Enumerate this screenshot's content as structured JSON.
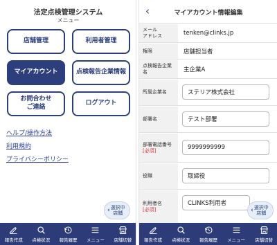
{
  "left": {
    "title": "法定点検管理システム",
    "subtitle": "メニュー",
    "buttons": [
      "店舗管理",
      "利用者管理",
      "マイアカウント",
      "点検報告企業情報",
      "お問合わせ\nご連絡",
      "ログアウト"
    ],
    "links": [
      "ヘルプ/操作方法",
      "利用規約",
      "プライバシーポリシー"
    ],
    "store_float": {
      "line1": "選択中",
      "line2": "店舗"
    }
  },
  "right": {
    "title": "マイアカウント情報編集",
    "fields": [
      {
        "label": "メール\nアドレス",
        "value": "tenken@clinks.jp"
      },
      {
        "label": "権限",
        "value": "店舗担当者"
      },
      {
        "label": "点検報告企業\n名",
        "value": "主企業A"
      },
      {
        "label": "所属企業名",
        "value": "ステリア株式会社"
      },
      {
        "label": "部署名",
        "value": "テスト部署"
      },
      {
        "label": "部署電話番号",
        "required": "[必須]",
        "value": "9999999999"
      },
      {
        "label": "役職",
        "value": "取締役"
      },
      {
        "label": "利用者名",
        "required": "[必須]",
        "value": "CLINKS利用者"
      }
    ],
    "store_float": {
      "line1": "選択中",
      "line2": "店舗"
    }
  },
  "nav": [
    "報告作成",
    "点検状況",
    "報告履歴",
    "メニュー",
    "店舗切替"
  ],
  "colors": {
    "primary": "#2c3f7c",
    "nav_bg": "#2d3c78",
    "link": "#2c3f9c",
    "required": "#d33333"
  },
  "icons": [
    "edit-icon",
    "search-icon",
    "history-icon",
    "menu-icon",
    "store-switch-icon",
    "back-chevron-icon"
  ]
}
